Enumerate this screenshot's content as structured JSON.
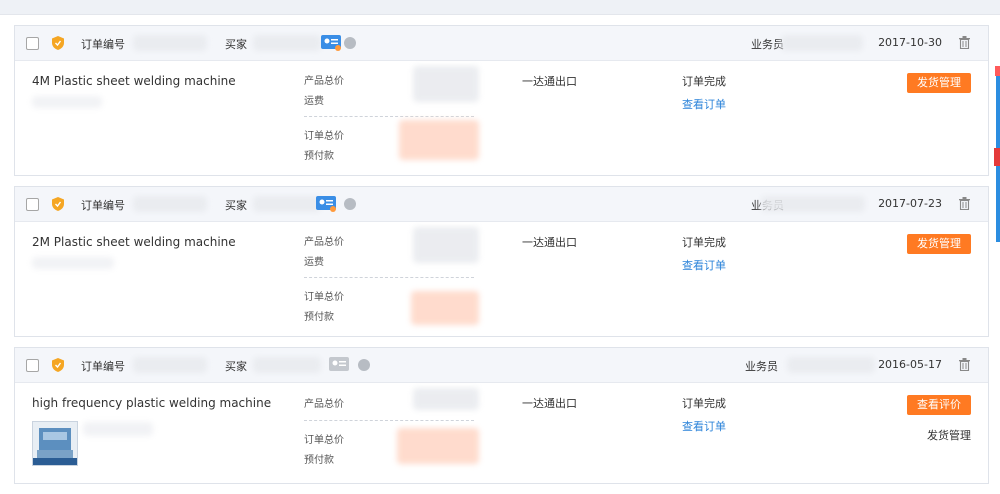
{
  "orders": [
    {
      "order_no_label": "订单编号",
      "buyer_label": "买家",
      "sales_label": "业务员",
      "date": "2017-10-30",
      "product": "4M Plastic sheet welding machine",
      "product_total_label": "产品总价",
      "freight_label": "运费",
      "order_total_label": "订单总价",
      "prepay_label": "预付款",
      "shipping": "一达通出口",
      "status": "订单完成",
      "view_order": "查看订单",
      "action": "发货管理"
    },
    {
      "order_no_label": "订单编号",
      "buyer_label": "买家",
      "sales_label": "业务员",
      "date": "2017-07-23",
      "product": "2M Plastic sheet welding machine",
      "product_total_label": "产品总价",
      "freight_label": "运费",
      "order_total_label": "订单总价",
      "prepay_label": "预付款",
      "shipping": "一达通出口",
      "status": "订单完成",
      "view_order": "查看订单",
      "action": "发货管理"
    },
    {
      "order_no_label": "订单编号",
      "buyer_label": "买家",
      "sales_label": "业务员",
      "date": "2016-05-17",
      "product": "high frequency plastic welding machine",
      "product_total_label": "产品总价",
      "order_total_label": "订单总价",
      "prepay_label": "预付款",
      "shipping": "一达通出口",
      "status": "订单完成",
      "view_order": "查看订单",
      "action": "查看评价",
      "secondary_action": "发货管理"
    }
  ],
  "colors": {
    "accent": "#ff7a22",
    "link": "#2b83d9",
    "header_bg": "#f4f6fa"
  },
  "icons": [
    "checkbox-icon",
    "shield-icon",
    "id-card-icon",
    "gray-dot-icon",
    "trash-icon"
  ]
}
